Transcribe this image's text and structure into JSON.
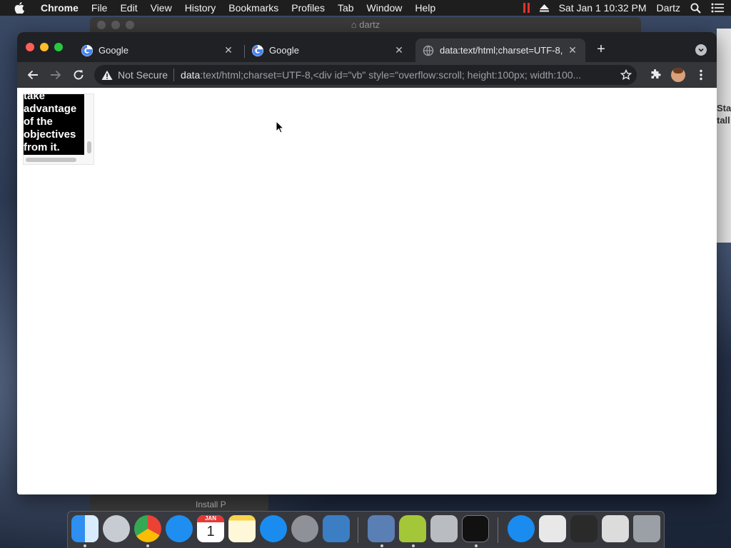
{
  "menubar": {
    "app_name": "Chrome",
    "items": [
      "File",
      "Edit",
      "View",
      "History",
      "Bookmarks",
      "Profiles",
      "Tab",
      "Window",
      "Help"
    ],
    "clock": "Sat Jan 1  10:32 PM",
    "user": "Dartz"
  },
  "background_window": {
    "title": "dartz",
    "side_text_1": "Sta",
    "side_text_2": "tall",
    "bottom_item_1": "Install P"
  },
  "browser": {
    "tabs": [
      {
        "title": "Google",
        "favicon": "google-icon",
        "active": false
      },
      {
        "title": "Google",
        "favicon": "google-icon",
        "active": false
      },
      {
        "title": "data:text/html;charset=UTF-8,",
        "favicon": "globe-icon",
        "active": true
      }
    ],
    "omnibox": {
      "security_label": "Not Secure",
      "url_scheme": "data",
      "url_rest": ":text/html;charset=UTF-8,<div id=\"vb\" style=\"overflow:scroll; height:100px; width:100..."
    }
  },
  "page": {
    "scroll_box_text": "take advantage of the objectives from it."
  },
  "dock": {
    "apps": [
      "finder-icon",
      "launchpad-icon",
      "chrome-icon",
      "safari-icon",
      "calendar-icon",
      "notes-icon",
      "app-store-icon",
      "system-preferences-icon",
      "virtualbox-icon",
      "sim-icon",
      "android-icon",
      "disk-utility-icon",
      "terminal-icon",
      "app-store-2-icon",
      "file-icon",
      "video-icon",
      "browser-window-icon",
      "trash-icon"
    ],
    "calendar_month": "JAN",
    "calendar_day": "1"
  }
}
